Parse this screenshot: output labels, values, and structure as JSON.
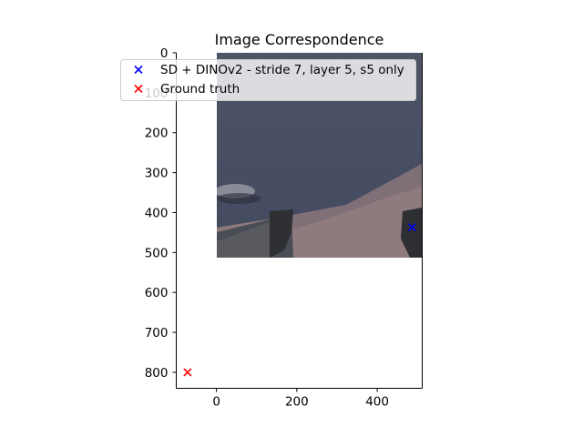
{
  "chart_data": {
    "type": "scatter",
    "title": "Image Correspondence",
    "xlabel": "",
    "ylabel": "",
    "xlim": [
      -100,
      512
    ],
    "ylim": [
      840,
      0
    ],
    "x_ticks": [
      0,
      200,
      400
    ],
    "y_ticks": [
      0,
      100,
      200,
      300,
      400,
      500,
      600,
      700,
      800
    ],
    "grid": false,
    "legend_position": "top-left",
    "background_image": {
      "description": "cropped photo patch",
      "extent_x": [
        0,
        512
      ],
      "extent_y": [
        512,
        0
      ]
    },
    "series": [
      {
        "name": "SD + DINOv2 - stride 7, layer 5, s5 only",
        "marker": "x",
        "color": "#0000ff",
        "points": [
          {
            "x": 487,
            "y": 437
          }
        ]
      },
      {
        "name": "Ground truth",
        "marker": "x",
        "color": "#ff0000",
        "points": [
          {
            "x": -72,
            "y": 800
          }
        ]
      }
    ]
  }
}
